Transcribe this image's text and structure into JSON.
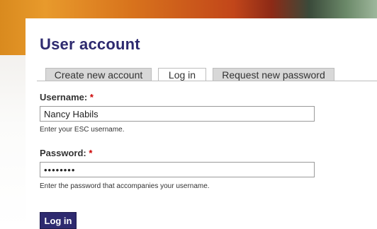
{
  "page": {
    "title": "User account"
  },
  "tabs": [
    {
      "label": "Create new account",
      "active": false
    },
    {
      "label": "Log in",
      "active": true
    },
    {
      "label": "Request new password",
      "active": false
    }
  ],
  "form": {
    "username": {
      "label": "Username:",
      "required_mark": "*",
      "value": "Nancy Habils",
      "description": "Enter your ESC username."
    },
    "password": {
      "label": "Password:",
      "required_mark": "*",
      "value": "••••••••",
      "description": "Enter the password that accompanies your username."
    },
    "submit_label": "Log in"
  },
  "colors": {
    "title": "#2e2a6f",
    "button": "#2e2a6f",
    "required": "#cc0000"
  }
}
